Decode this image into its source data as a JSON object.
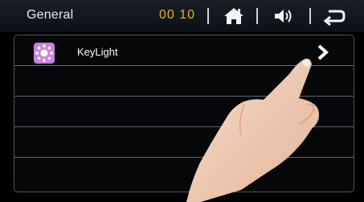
{
  "header": {
    "title": "General",
    "clock": "00 10",
    "icons": [
      "home-icon",
      "volume-icon",
      "back-icon"
    ],
    "clock_color": "#e8b21a"
  },
  "list": {
    "items": [
      {
        "label": "KeyLight",
        "icon": "brightness-icon",
        "icon_bg": "#c985dc",
        "has_chevron": true
      },
      {
        "label": ""
      },
      {
        "label": ""
      },
      {
        "label": ""
      },
      {
        "label": ""
      }
    ]
  }
}
